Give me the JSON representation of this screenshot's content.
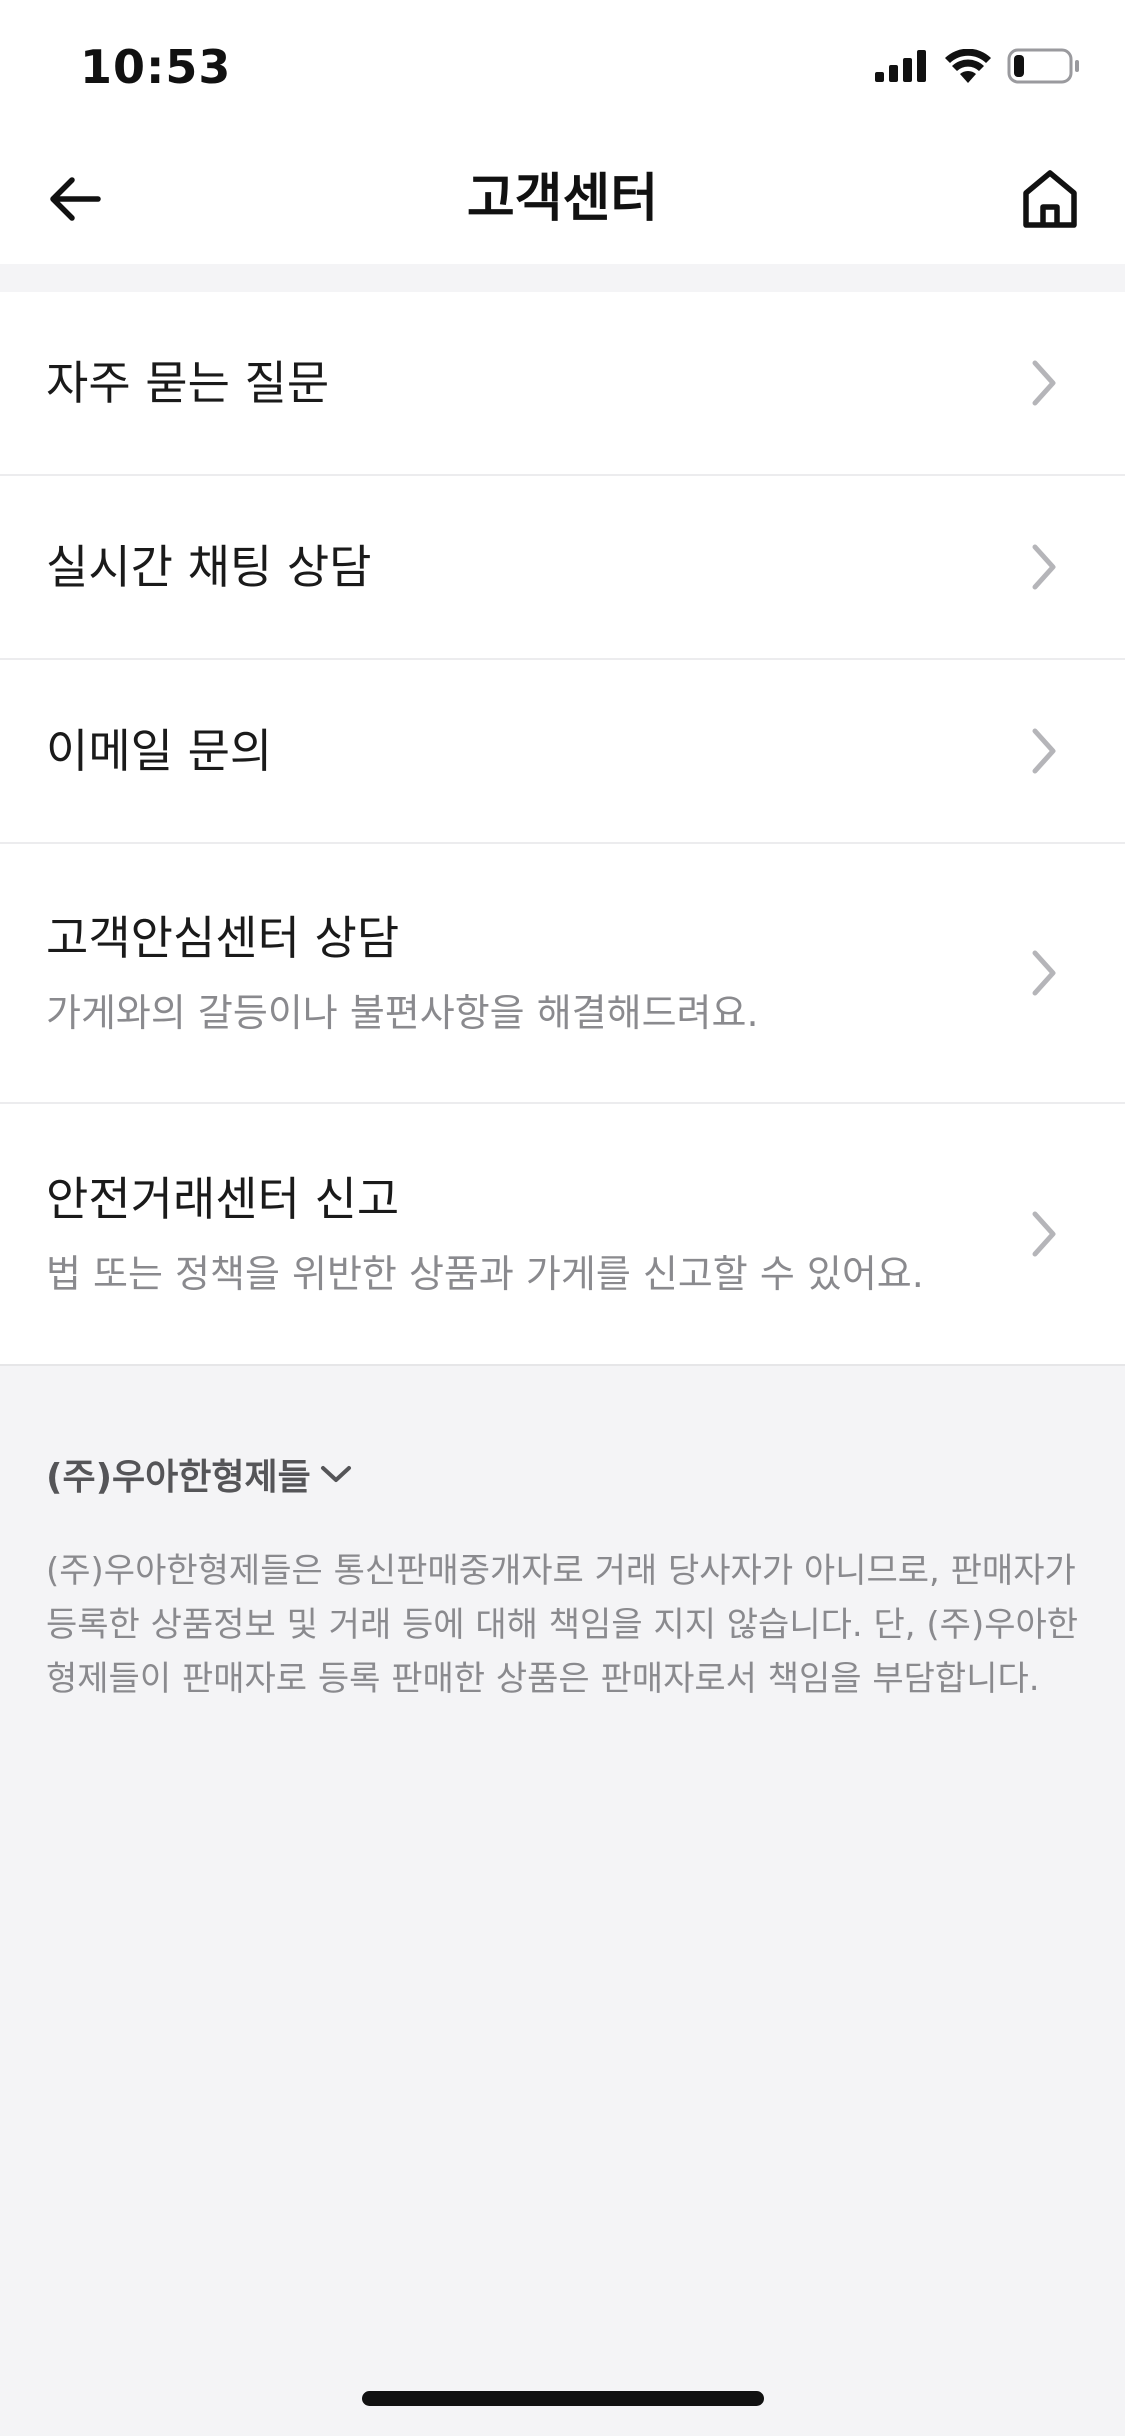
{
  "status_bar": {
    "time": "10:53"
  },
  "nav": {
    "title": "고객센터"
  },
  "menu": {
    "items": [
      {
        "label": "자주 묻는 질문"
      },
      {
        "label": "실시간 채팅 상담"
      },
      {
        "label": "이메일 문의"
      },
      {
        "label": "고객안심센터 상담",
        "sub": "가게와의 갈등이나 불편사항을 해결해드려요."
      },
      {
        "label": "안전거래센터 신고",
        "sub": "법 또는 정책을 위반한 상품과 가게를 신고할 수 있어요."
      }
    ]
  },
  "footer": {
    "company": "(주)우아한형제들",
    "disclaimer": "(주)우아한형제들은 통신판매중개자로 거래 당사자가 아니므로, 판매자가 등록한 상품정보 및 거래 등에 대해 책임을 지지 않습니다. 단, (주)우아한형제들이 판매자로 등록 판매한 상품은 판매자로서 책임을 부담합니다."
  },
  "icons": {
    "back": "arrow-left-icon",
    "home": "home-icon",
    "chevron": "chevron-right-icon",
    "expand": "chevron-down-icon",
    "signal": "cellular-signal-icon",
    "wifi": "wifi-icon",
    "battery": "battery-icon"
  },
  "colors": {
    "background": "#f4f4f6",
    "surface": "#ffffff",
    "text_primary": "#1a1a1a",
    "text_secondary": "#8a8a8e",
    "chevron": "#b5b5b9"
  },
  "battery": {
    "level": 0.2
  }
}
